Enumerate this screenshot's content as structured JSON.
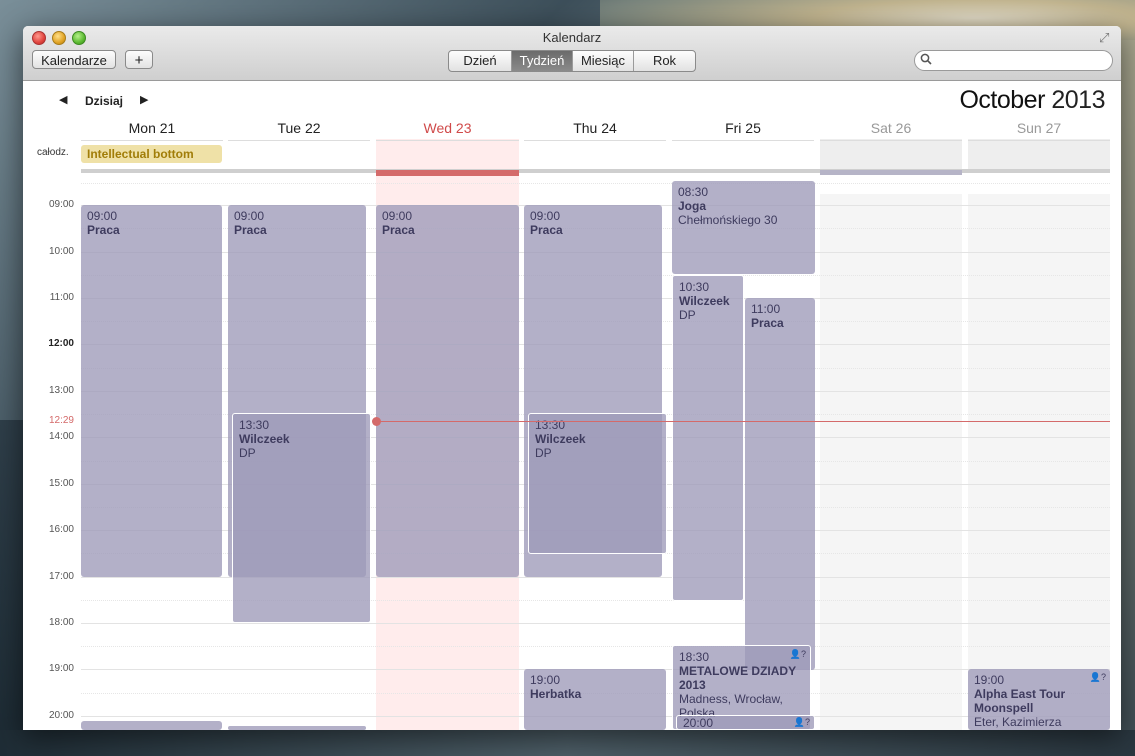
{
  "window": {
    "title": "Kalendarz"
  },
  "toolbar": {
    "calendars_label": "Kalendarze",
    "add_label": "+",
    "views": [
      {
        "label": "Dzień",
        "active": false
      },
      {
        "label": "Tydzień",
        "active": true
      },
      {
        "label": "Miesiąc",
        "active": false
      },
      {
        "label": "Rok",
        "active": false
      }
    ],
    "search_placeholder": ""
  },
  "nav": {
    "today_label": "Dzisiaj",
    "month": "October",
    "year": "2013"
  },
  "days": [
    {
      "label": "Mon 21",
      "state": "normal"
    },
    {
      "label": "Tue 22",
      "state": "normal"
    },
    {
      "label": "Wed 23",
      "state": "today"
    },
    {
      "label": "Thu 24",
      "state": "normal"
    },
    {
      "label": "Fri 25",
      "state": "normal"
    },
    {
      "label": "Sat 26",
      "state": "weekend"
    },
    {
      "label": "Sun 27",
      "state": "weekend"
    }
  ],
  "allday": {
    "label": "całodz.",
    "events": [
      {
        "title": "Intellectual bottom",
        "day": "Mon 21"
      }
    ]
  },
  "hours": [
    "09:00",
    "10:00",
    "11:00",
    "12:00",
    "13:00",
    "14:00",
    "15:00",
    "16:00",
    "17:00",
    "18:00",
    "19:00",
    "20:00"
  ],
  "current_time": "12:29",
  "events": [
    {
      "day": "Mon 21",
      "time": "09:00",
      "title": "Praca",
      "location": ""
    },
    {
      "day": "Tue 22",
      "time": "09:00",
      "title": "Praca",
      "location": ""
    },
    {
      "day": "Tue 22",
      "time": "13:30",
      "title": "Wilczeek",
      "location": "DP"
    },
    {
      "day": "Wed 23",
      "time": "09:00",
      "title": "Praca",
      "location": ""
    },
    {
      "day": "Thu 24",
      "time": "09:00",
      "title": "Praca",
      "location": ""
    },
    {
      "day": "Thu 24",
      "time": "13:30",
      "title": "Wilczeek",
      "location": "DP"
    },
    {
      "day": "Thu 24",
      "time": "19:00",
      "title": "Herbatka",
      "location": ""
    },
    {
      "day": "Fri 25",
      "time": "08:30",
      "title": "Joga",
      "location": "Chełmońskiego 30"
    },
    {
      "day": "Fri 25",
      "time": "10:30",
      "title": "Wilczeek",
      "location": "DP"
    },
    {
      "day": "Fri 25",
      "time": "11:00",
      "title": "Praca",
      "location": ""
    },
    {
      "day": "Fri 25",
      "time": "18:30",
      "title": "METALOWE DZIADY 2013",
      "location": "Madness, Wrocław, Polska"
    },
    {
      "day": "Fri 25",
      "time": "20:00",
      "title": "",
      "location": ""
    },
    {
      "day": "Sun 27",
      "time": "19:00",
      "title": "Alpha East Tour Moonspell",
      "location": "Eter, Kazimierza"
    }
  ],
  "icons": {
    "search": "search-icon",
    "fullscreen": "fullscreen-icon",
    "prev": "chevron-left-icon",
    "next": "chevron-right-icon",
    "invite": "invitation-icon"
  },
  "colors": {
    "event": "#9d9ab9",
    "today": "#d46a6a",
    "allday_event": "#efe1a7",
    "allday_text": "#a17d08"
  }
}
